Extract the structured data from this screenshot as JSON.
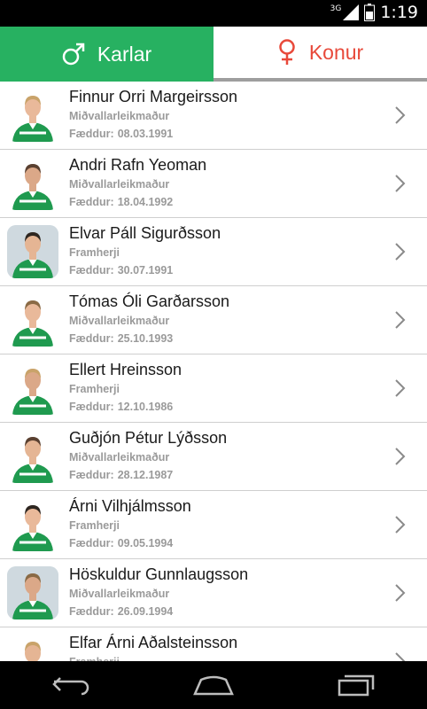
{
  "status": {
    "network": "3G",
    "time": "1:19"
  },
  "tabs": [
    {
      "label": "Karlar",
      "icon": "male-symbol-icon",
      "active": true
    },
    {
      "label": "Konur",
      "icon": "female-symbol-icon",
      "active": false
    }
  ],
  "colors": {
    "accent": "#27b161",
    "female": "#e8493a",
    "meta_text": "#9a9a9a"
  },
  "born_label": "Fæddur:",
  "players": [
    {
      "name": "Finnur Orri Margeirsson",
      "position": "Miðvallarleikmaður",
      "born": "08.03.1991",
      "photo": "cutout"
    },
    {
      "name": "Andri Rafn Yeoman",
      "position": "Miðvallarleikmaður",
      "born": "18.04.1992",
      "photo": "cutout"
    },
    {
      "name": "Elvar Páll Sigurðsson",
      "position": "Framherji",
      "born": "30.07.1991",
      "photo": "photo"
    },
    {
      "name": "Tómas Óli Garðarsson",
      "position": "Miðvallarleikmaður",
      "born": "25.10.1993",
      "photo": "cutout"
    },
    {
      "name": "Ellert Hreinsson",
      "position": "Framherji",
      "born": "12.10.1986",
      "photo": "cutout"
    },
    {
      "name": "Guðjón Pétur Lýðsson",
      "position": "Miðvallarleikmaður",
      "born": "28.12.1987",
      "photo": "cutout"
    },
    {
      "name": "Árni Vilhjálmsson",
      "position": "Framherji",
      "born": "09.05.1994",
      "photo": "cutout"
    },
    {
      "name": "Höskuldur Gunnlaugsson",
      "position": "Miðvallarleikmaður",
      "born": "26.09.1994",
      "photo": "photo"
    },
    {
      "name": "Elfar Árni Aðalsteinsson",
      "position": "Framherji",
      "born": "",
      "photo": "cutout"
    }
  ],
  "navbar": [
    "back-icon",
    "home-icon",
    "recent-apps-icon"
  ]
}
